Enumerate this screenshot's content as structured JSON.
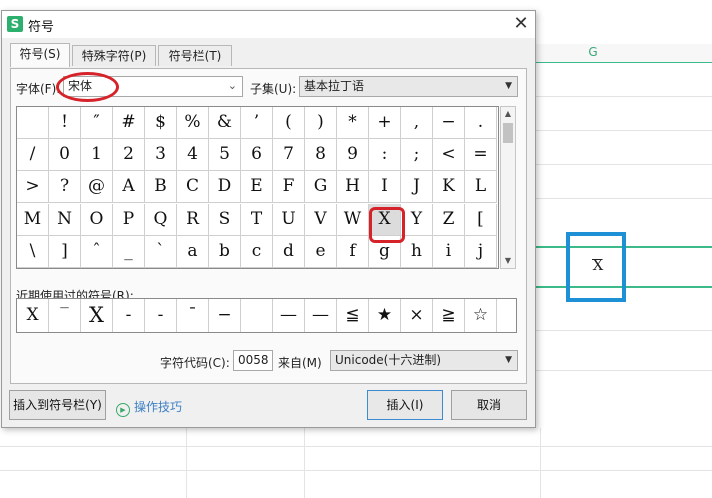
{
  "spreadsheet": {
    "column_letter": "G",
    "cell_value": "X"
  },
  "dialog": {
    "title": "符号",
    "app_icon_letter": "S",
    "close_glyph": "✕",
    "tabs": [
      {
        "label": "符号(S)",
        "active": true
      },
      {
        "label": "特殊字符(P)",
        "active": false
      },
      {
        "label": "符号栏(T)",
        "active": false
      }
    ],
    "font_label": "字体(F):",
    "font_value": "宋体",
    "subset_label": "子集(U):",
    "subset_value": "基本拉丁语",
    "symbols": [
      [
        "",
        "!",
        "″",
        "#",
        "$",
        "%",
        "&",
        "’",
        "(",
        ")",
        "*",
        "+",
        ",",
        "−",
        "."
      ],
      [
        "/",
        "0",
        "1",
        "2",
        "3",
        "4",
        "5",
        "6",
        "7",
        "8",
        "9",
        ":",
        ";",
        "<",
        "="
      ],
      [
        ">",
        "?",
        "@",
        "A",
        "B",
        "C",
        "D",
        "E",
        "F",
        "G",
        "H",
        "I",
        "J",
        "K",
        "L"
      ],
      [
        "M",
        "N",
        "O",
        "P",
        "Q",
        "R",
        "S",
        "T",
        "U",
        "V",
        "W",
        "X",
        "Y",
        "Z",
        "["
      ],
      [
        "\\",
        "]",
        "ˆ",
        "_",
        "ˋ",
        "a",
        "b",
        "c",
        "d",
        "e",
        "f",
        "g",
        "h",
        "i",
        "j"
      ]
    ],
    "selected_symbol": "X",
    "recent_label": "近期使用过的符号(R):",
    "recent_symbols": [
      "X",
      "‾",
      "X",
      "-",
      "-",
      "¯",
      "−",
      "",
      "—",
      "—",
      "≦",
      "★",
      "×",
      "≧",
      "☆"
    ],
    "char_code_label": "字符代码(C):",
    "char_code_value": "0058",
    "from_label": "来自(M)",
    "from_value": "Unicode(十六进制)",
    "insert_to_bar_label": "插入到符号栏(Y)",
    "tips_label": "操作技巧",
    "insert_label": "插入(I)",
    "cancel_label": "取消"
  },
  "colors": {
    "annotation_red": "#d6232a",
    "highlight_blue": "#1e90d6",
    "sheet_green": "#3dba8a"
  }
}
